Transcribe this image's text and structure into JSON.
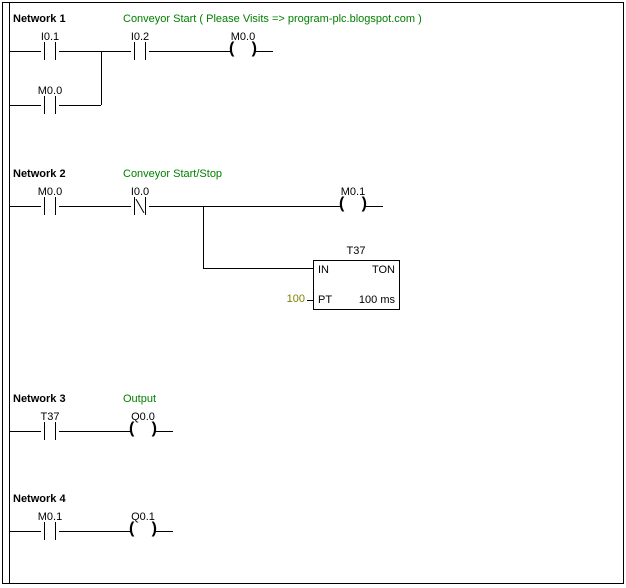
{
  "network1": {
    "title": "Network 1",
    "comment": "Conveyor Start ( Please Visits => program-plc.blogspot.com )",
    "contact1": "I0.1",
    "contact2": "I0.2",
    "coil": "M0.0",
    "parallel_contact": "M0.0"
  },
  "network2": {
    "title": "Network 2",
    "comment": "Conveyor Start/Stop",
    "contact1": "M0.0",
    "contact2": "I0.0",
    "coil": "M0.1",
    "timer_name": "T37",
    "timer_in": "IN",
    "timer_type": "TON",
    "timer_pt": "PT",
    "timer_res": "100 ms",
    "pt_value": "100"
  },
  "network3": {
    "title": "Network 3",
    "comment": "Output",
    "contact1": "T37",
    "coil": "Q0.0"
  },
  "network4": {
    "title": "Network 4",
    "contact1": "M0.1",
    "coil": "Q0.1"
  }
}
